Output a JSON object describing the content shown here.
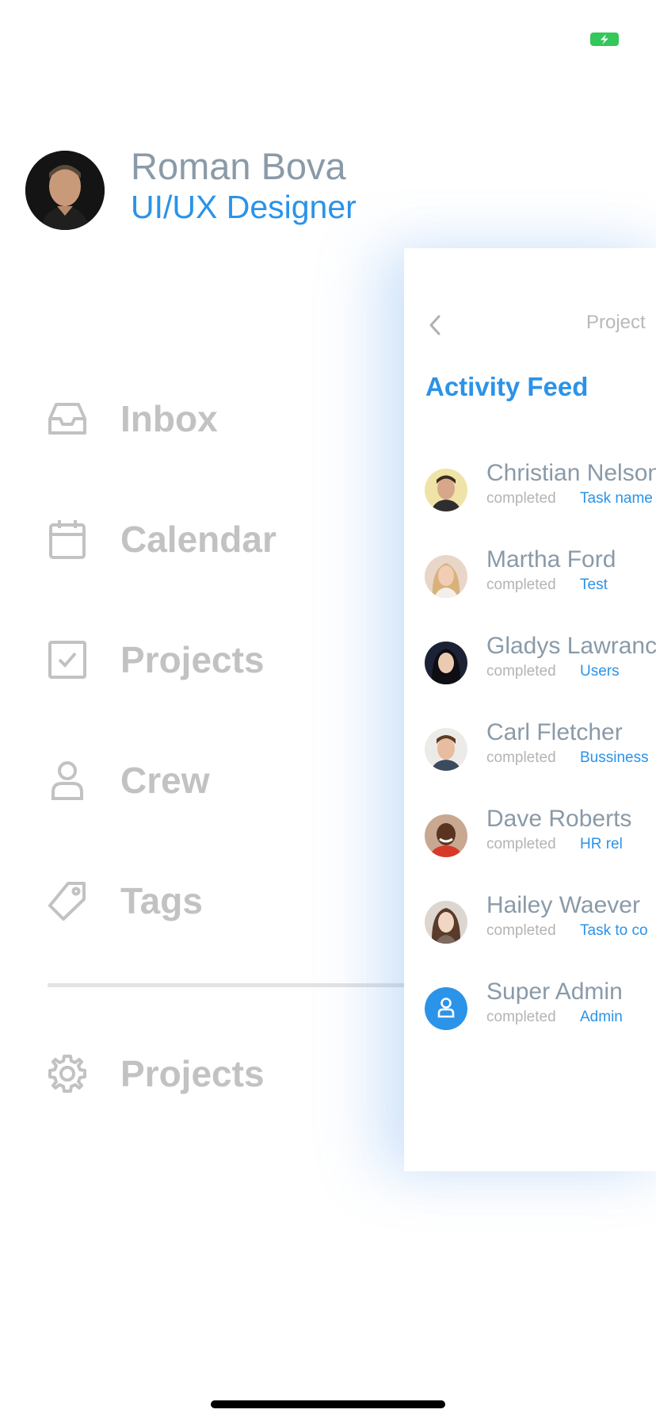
{
  "colors": {
    "accent": "#2b93e8",
    "name_gray": "#8a9aa8",
    "menu_gray": "#c2c2c2",
    "battery_green": "#34c759"
  },
  "status_bar": {
    "battery_icon": "battery-charging-icon"
  },
  "profile": {
    "name": "Roman Bova",
    "role": "UI/UX Designer",
    "avatar_icon": "user-photo-avatar"
  },
  "menu": {
    "items": [
      {
        "label": "Inbox",
        "icon": "inbox-tray-icon"
      },
      {
        "label": "Calendar",
        "icon": "calendar-icon"
      },
      {
        "label": "Projects",
        "icon": "checkbox-icon"
      },
      {
        "label": "Crew",
        "icon": "person-icon"
      },
      {
        "label": "Tags",
        "icon": "tag-icon"
      }
    ],
    "settings": {
      "label": "Projects",
      "icon": "gear-icon"
    }
  },
  "panel": {
    "back_icon": "chevron-left-icon",
    "header_title": "Project",
    "title": "Activity Feed",
    "feed": [
      {
        "name": "Christian Nelson",
        "status": "completed",
        "task": "Task name"
      },
      {
        "name": "Martha Ford",
        "status": "completed",
        "task": "Test"
      },
      {
        "name": "Gladys Lawrance",
        "status": "completed",
        "task": "Users"
      },
      {
        "name": "Carl Fletcher",
        "status": "completed",
        "task": "Bussiness"
      },
      {
        "name": "Dave Roberts",
        "status": "completed",
        "task": "HR rel"
      },
      {
        "name": "Hailey Waever",
        "status": "completed",
        "task": "Task to co"
      },
      {
        "name": "Super Admin",
        "status": "completed",
        "task": "Admin"
      }
    ]
  }
}
